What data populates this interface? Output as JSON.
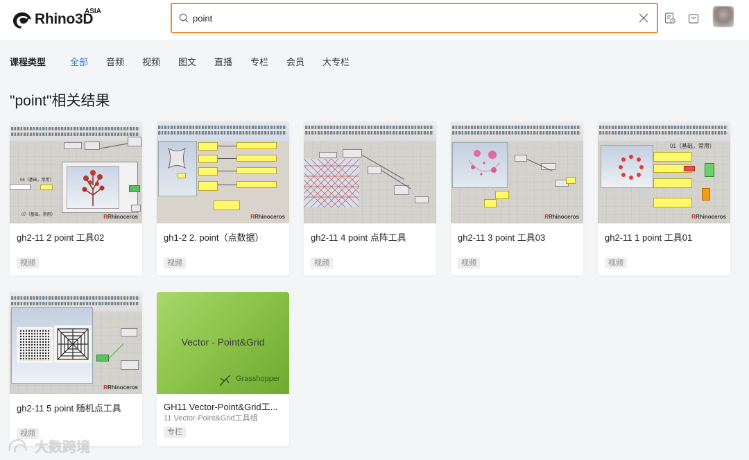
{
  "header": {
    "logo_text": "Rhino3D",
    "logo_badge": "ASIA",
    "search": {
      "value": "point",
      "placeholder": ""
    },
    "icons": [
      "search-icon",
      "clear-icon",
      "study-record-icon",
      "cart-icon",
      "avatar"
    ]
  },
  "filters": {
    "label": "课程类型",
    "tabs": [
      "全部",
      "音频",
      "视频",
      "图文",
      "直播",
      "专栏",
      "会员",
      "大专栏"
    ],
    "active_index": 0
  },
  "results_title": "\"point\"相关结果",
  "cards": [
    {
      "title": "gh2-11 2 point 工具02",
      "subtitle": "",
      "tag": "视频"
    },
    {
      "title": "gh1-2 2. point（点数据）",
      "subtitle": "",
      "tag": "视频"
    },
    {
      "title": "gh2-11 4 point 点阵工具",
      "subtitle": "",
      "tag": "视频"
    },
    {
      "title": "gh2-11 3 point 工具03",
      "subtitle": "",
      "tag": "视频"
    },
    {
      "title": "gh2-11 1 point 工具01",
      "subtitle": "",
      "tag": "视频"
    },
    {
      "title": "gh2-11 5 point 随机点工具",
      "subtitle": "",
      "tag": "视频"
    },
    {
      "title": "GH11 Vector-Point&Grid工...",
      "subtitle": "11 Vector-Point&Grid工具组",
      "tag": "专栏"
    }
  ],
  "thumb_text": {
    "card1_labels": [
      "06（基础，常用）",
      "07（基础，常用）"
    ],
    "card5_label": "01（基础，常用）",
    "card7_title": "Vector - Point&Grid",
    "card7_brand": "Grasshopper",
    "rhino_brand": "Rhinoceros"
  },
  "watermark": "大数跨境",
  "colors": {
    "accent": "#3a7bd5",
    "search_border": "#f08a2c",
    "tag_bg": "#eeeeee"
  }
}
